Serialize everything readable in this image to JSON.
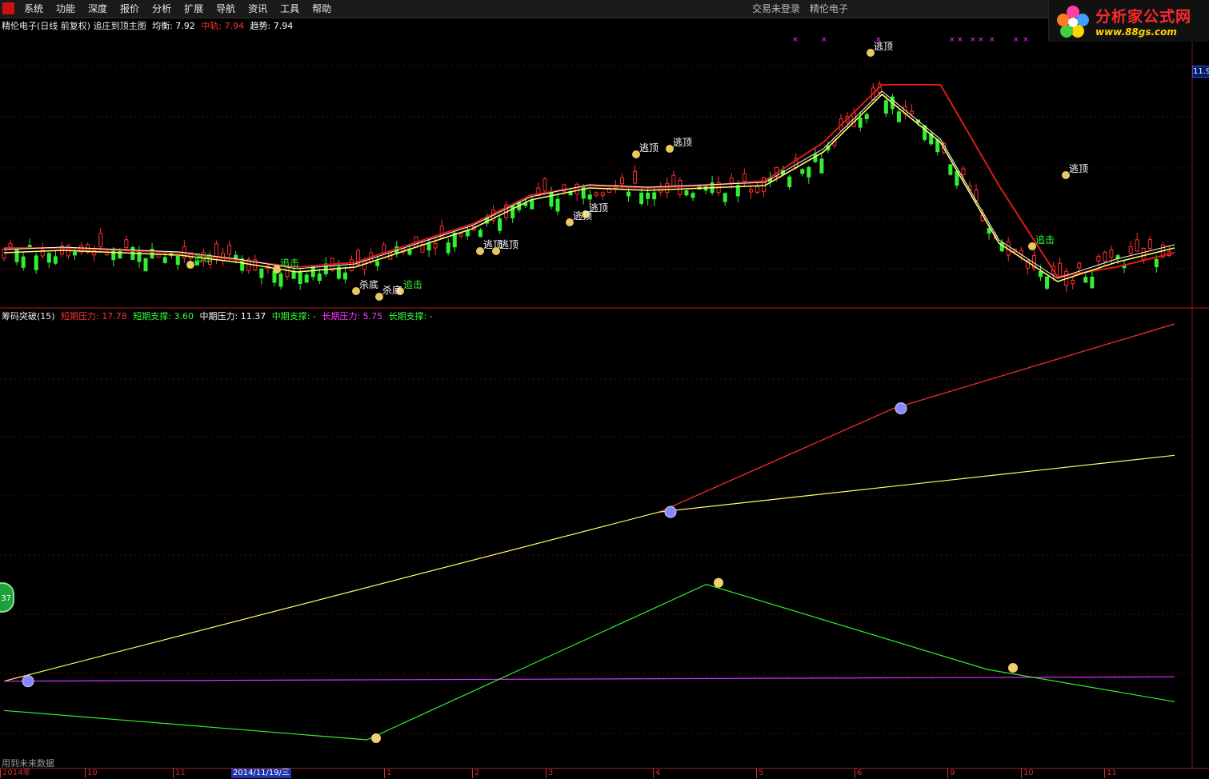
{
  "menubar": {
    "items": [
      "系统",
      "功能",
      "深度",
      "报价",
      "分析",
      "扩展",
      "导航",
      "资讯",
      "工具",
      "帮助"
    ],
    "login_status": "交易未登录",
    "stock_name": "精伦电子"
  },
  "brand": {
    "name": "分析家公式网",
    "url": "www.88gs.com"
  },
  "main_panel": {
    "title": "精伦电子(日线 前复权) 追庄到顶主图",
    "legend": [
      {
        "label": "均衡:",
        "value": "7.92",
        "color": "#ffffff"
      },
      {
        "label": "中轨:",
        "value": "7.94",
        "color": "#ff3030"
      },
      {
        "label": "趋势:",
        "value": "7.94",
        "color": "#ffffff"
      }
    ],
    "price_tag": "11.9",
    "signals": {
      "top": "逃顶",
      "chase": "追击",
      "bottom": "杀底"
    }
  },
  "sub_panel": {
    "title": "筹码突破(15)",
    "legend": [
      {
        "label": "短期压力:",
        "value": "17.78",
        "color": "#ff3030"
      },
      {
        "label": "短期支撑:",
        "value": "3.60",
        "color": "#33ff33"
      },
      {
        "label": "中期压力:",
        "value": "11.37",
        "color": "#ffffff"
      },
      {
        "label": "中期支撑:",
        "value": "-",
        "color": "#33ff33"
      },
      {
        "label": "长期压力:",
        "value": "5.75",
        "color": "#ff33ff"
      },
      {
        "label": "长期支撑:",
        "value": "-",
        "color": "#33ff33"
      }
    ]
  },
  "bottom_note": "用到未来数据",
  "side_badge": "37",
  "timeaxis": {
    "ticks": [
      "2014年",
      "10",
      "11",
      "1",
      "2",
      "3",
      "4",
      "5",
      "6",
      "9",
      "10",
      "11"
    ],
    "cursor_date": "2014/11/19/三"
  },
  "colors": {
    "up": "#ff3030",
    "down": "#33ee33",
    "line_white": "#ffffff",
    "line_yellow": "#ffff66",
    "line_red": "#dd1a1a",
    "line_magenta": "#dd33ff"
  },
  "chart_data": [
    {
      "type": "line",
      "series": [
        {
          "name": "中轨",
          "x": [
            0,
            5,
            10,
            15,
            20,
            25,
            30,
            35,
            40,
            45,
            50,
            55,
            60,
            65,
            70,
            75,
            80,
            85,
            90,
            95,
            100
          ],
          "values": [
            8.1,
            8.1,
            8.05,
            8.0,
            7.85,
            7.7,
            7.8,
            8.2,
            8.6,
            9.2,
            9.4,
            9.35,
            9.4,
            9.5,
            10.3,
            11.5,
            11.5,
            9.4,
            7.5,
            7.7,
            8.0
          ]
        },
        {
          "name": "趋势",
          "x": [
            0,
            5,
            10,
            15,
            20,
            25,
            30,
            35,
            40,
            45,
            50,
            55,
            60,
            65,
            70,
            75,
            80,
            85,
            90,
            95,
            100
          ],
          "values": [
            8.0,
            8.05,
            8.0,
            7.95,
            7.8,
            7.6,
            7.7,
            8.1,
            8.5,
            9.1,
            9.35,
            9.3,
            9.35,
            9.4,
            10.1,
            11.3,
            10.3,
            8.2,
            7.4,
            7.8,
            8.1
          ]
        }
      ]
    },
    {
      "type": "line",
      "series": [
        {
          "name": "短期压力",
          "x": [
            0,
            56,
            76,
            100
          ],
          "values": [
            null,
            11.37,
            14.9,
            17.78
          ]
        },
        {
          "name": "中期压力",
          "x": [
            0,
            56,
            100
          ],
          "values": [
            5.6,
            11.37,
            13.3
          ]
        },
        {
          "name": "长期压力",
          "x": [
            0,
            100
          ],
          "values": [
            5.6,
            5.75
          ]
        },
        {
          "name": "短期支撑",
          "x": [
            0,
            31,
            60,
            84,
            100
          ],
          "values": [
            4.6,
            3.6,
            8.9,
            6.0,
            4.9
          ]
        }
      ]
    }
  ]
}
